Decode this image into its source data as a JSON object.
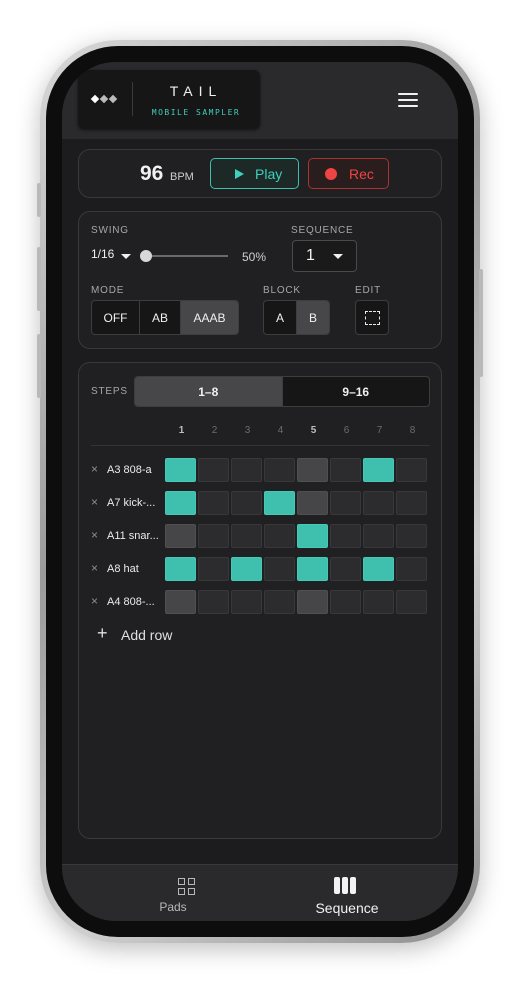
{
  "header": {
    "app_title": "TAIL",
    "app_subtitle": "MOBILE SAMPLER"
  },
  "transport": {
    "bpm": "96",
    "bpm_unit": "BPM",
    "play_label": "Play",
    "rec_label": "Rec"
  },
  "settings": {
    "swing_label": "SWING",
    "swing_division": "1/16",
    "swing_amount": "50%",
    "swing_fraction": 0.1,
    "sequence_label": "SEQUENCE",
    "sequence_value": "1",
    "mode_label": "MODE",
    "mode_options": [
      "OFF",
      "AB",
      "AAAB"
    ],
    "mode_selected": "AAAB",
    "block_label": "BLOCK",
    "block_options": [
      "A",
      "B"
    ],
    "block_selected": "B",
    "edit_label": "EDIT"
  },
  "steps": {
    "label": "STEPS",
    "tabs": [
      "1–8",
      "9–16"
    ],
    "tab_selected": "1–8",
    "columns": [
      "1",
      "2",
      "3",
      "4",
      "5",
      "6",
      "7",
      "8"
    ],
    "rows": [
      {
        "name": "A3 808-a",
        "steps": [
          1,
          0,
          0,
          0,
          0,
          0,
          1,
          0
        ]
      },
      {
        "name": "A7 kick-...",
        "steps": [
          1,
          0,
          0,
          1,
          0,
          0,
          0,
          0
        ]
      },
      {
        "name": "A11 snar...",
        "steps": [
          0,
          0,
          0,
          0,
          1,
          0,
          0,
          0
        ]
      },
      {
        "name": "A8 hat",
        "steps": [
          1,
          0,
          1,
          0,
          1,
          0,
          1,
          0
        ]
      },
      {
        "name": "A4 808-...",
        "steps": [
          0,
          0,
          0,
          0,
          0,
          0,
          0,
          0
        ]
      }
    ],
    "add_row_label": "Add row"
  },
  "tabbar": {
    "pads_label": "Pads",
    "sequence_label": "Sequence",
    "active": "Sequence"
  },
  "colors": {
    "accent": "#3fbfae",
    "record": "#ee4444",
    "background": "#1c1c1e"
  }
}
